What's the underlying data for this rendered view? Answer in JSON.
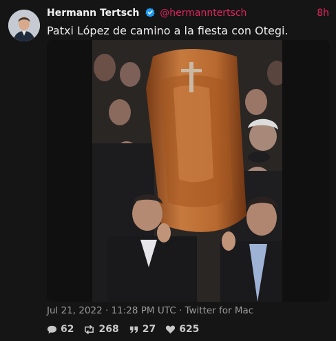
{
  "tweet": {
    "display_name": "Hermann Tertsch",
    "handle": "@hermanntertsch",
    "time_ago": "8h",
    "text": "Patxi López de camino a la fiesta con Otegi.",
    "meta": {
      "date": "Jul 21, 2022",
      "sep1": " · ",
      "time": "11:28 PM UTC",
      "sep2": " · ",
      "client": "Twitter for Mac"
    },
    "actions": [
      {
        "name": "replies",
        "icon": "comment-icon",
        "count": "62"
      },
      {
        "name": "retweets",
        "icon": "retweet-icon",
        "count": "268"
      },
      {
        "name": "quotes",
        "icon": "quote-icon",
        "count": "27"
      },
      {
        "name": "likes",
        "icon": "heart-icon",
        "count": "625"
      }
    ]
  },
  "colors": {
    "background": "#151515",
    "accent": "#e0245e",
    "verified": "#1d9bf0",
    "muted": "#9a9a9a"
  }
}
